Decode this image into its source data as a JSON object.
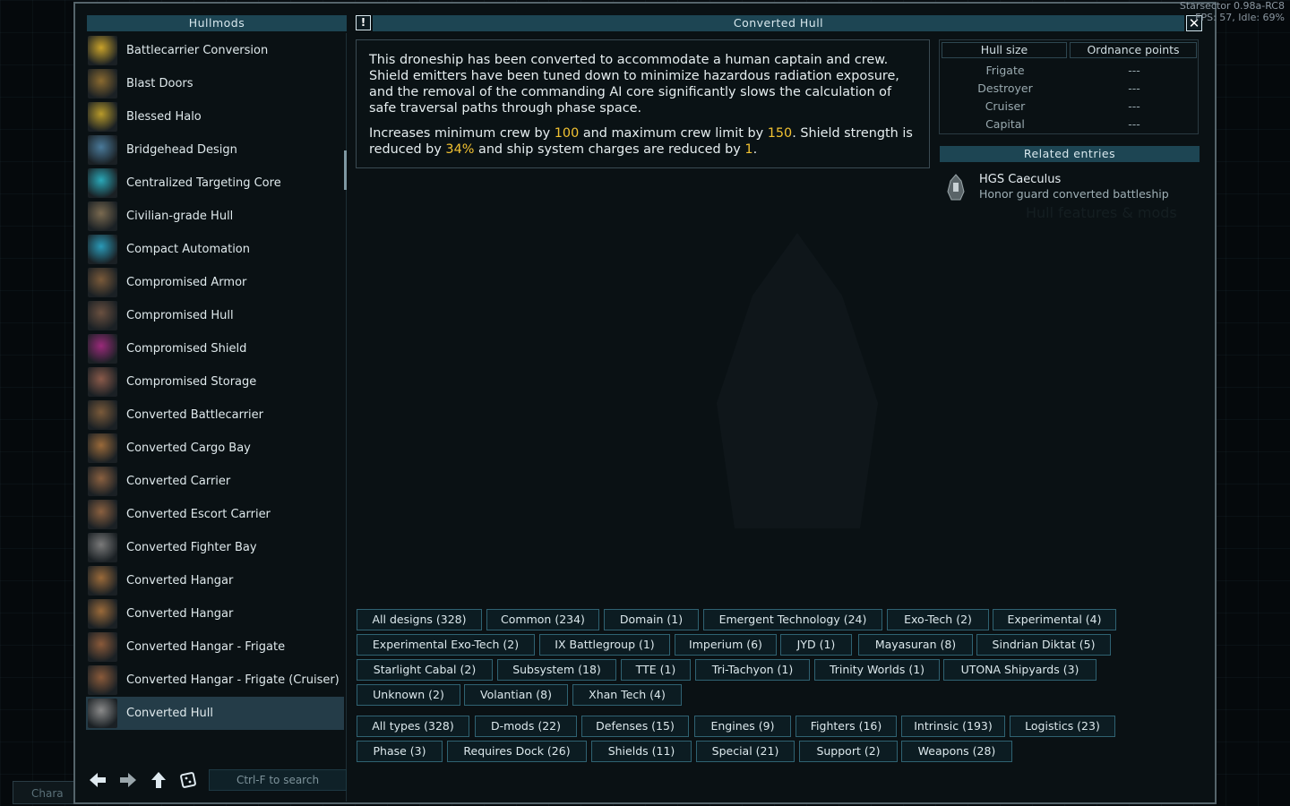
{
  "version": {
    "line1": "Starsector 0.98a-RC8",
    "line2": "FPS: 57, Idle: 69%"
  },
  "char_tab": "Chara",
  "hullmods_header": "Hullmods",
  "detail_header": "Converted Hull",
  "warning_icon": "!",
  "close_icon": "✕",
  "list_items": [
    {
      "label": "Battlecarrier Conversion",
      "icon": "battlecarrier-icon",
      "color": "#c9a22a"
    },
    {
      "label": "Blast Doors",
      "icon": "blast-doors-icon",
      "color": "#8a6a30"
    },
    {
      "label": "Blessed Halo",
      "icon": "halo-icon",
      "color": "#b89a2a"
    },
    {
      "label": "Bridgehead Design",
      "icon": "bridgehead-icon",
      "color": "#4a7a9a"
    },
    {
      "label": "Centralized Targeting Core",
      "icon": "targeting-core-icon",
      "color": "#2aa8b8"
    },
    {
      "label": "Civilian-grade Hull",
      "icon": "civilian-hull-icon",
      "color": "#7a6a50"
    },
    {
      "label": "Compact Automation",
      "icon": "automation-icon",
      "color": "#2a9ab8"
    },
    {
      "label": "Compromised Armor",
      "icon": "compromised-armor-icon",
      "color": "#7a5a3a"
    },
    {
      "label": "Compromised Hull",
      "icon": "compromised-hull-icon",
      "color": "#6a5040"
    },
    {
      "label": "Compromised Shield",
      "icon": "compromised-shield-icon",
      "color": "#9a2a7a"
    },
    {
      "label": "Compromised Storage",
      "icon": "compromised-storage-icon",
      "color": "#8a5a4a"
    },
    {
      "label": "Converted Battlecarrier",
      "icon": "converted-battlecarrier-icon",
      "color": "#7a5a3a"
    },
    {
      "label": "Converted Cargo Bay",
      "icon": "cargo-bay-icon",
      "color": "#9a6a3a"
    },
    {
      "label": "Converted Carrier",
      "icon": "converted-carrier-icon",
      "color": "#8a6040"
    },
    {
      "label": "Converted Escort Carrier",
      "icon": "escort-carrier-icon",
      "color": "#8a6040"
    },
    {
      "label": "Converted Fighter Bay",
      "icon": "fighter-bay-icon",
      "color": "#7a7a7a"
    },
    {
      "label": "Converted Hangar",
      "icon": "hangar-icon",
      "color": "#9a6a3a"
    },
    {
      "label": "Converted Hangar",
      "icon": "hangar-icon",
      "color": "#9a6a3a"
    },
    {
      "label": "Converted Hangar - Frigate",
      "icon": "hangar-frigate-icon",
      "color": "#8a5a3a"
    },
    {
      "label": "Converted Hangar - Frigate (Cruiser)",
      "icon": "hangar-frigate-cruiser-icon",
      "color": "#8a5a3a"
    },
    {
      "label": "Converted Hull",
      "icon": "converted-hull-icon",
      "color": "#8a8a8a",
      "selected": true
    }
  ],
  "search_placeholder": "Ctrl-F to search",
  "description": {
    "p1": "This droneship has been converted to accommodate a human captain and crew. Shield emitters have been tuned down to minimize hazardous radiation exposure, and the removal of the commanding AI core significantly slows the calculation of safe traversal paths through phase space.",
    "p2_a": "Increases minimum crew by ",
    "p2_v1": "100",
    "p2_b": " and maximum crew limit by ",
    "p2_v2": "150",
    "p2_c": ". Shield strength is reduced by ",
    "p2_v3": "34%",
    "p2_d": " and ship system charges are reduced by ",
    "p2_v4": "1",
    "p2_e": "."
  },
  "hull_table": {
    "col_size": "Hull size",
    "col_op": "Ordnance points",
    "rows": [
      {
        "size": "Frigate",
        "op": "---"
      },
      {
        "size": "Destroyer",
        "op": "---"
      },
      {
        "size": "Cruiser",
        "op": "---"
      },
      {
        "size": "Capital",
        "op": "---"
      }
    ]
  },
  "related_header": "Related entries",
  "related": {
    "name": "HGS Caeculus",
    "sub": "Honor guard converted battleship"
  },
  "design_filters": [
    "All designs (328)",
    "Common (234)",
    "Domain (1)",
    "Emergent Technology (24)",
    "Exo-Tech (2)",
    "Experimental (4)",
    "Experimental Exo-Tech (2)",
    "IX Battlegroup (1)",
    "Imperium (6)",
    "JYD (1)",
    "Mayasuran (8)",
    "Sindrian Diktat (5)",
    "Starlight Cabal (2)",
    "Subsystem (18)",
    "TTE (1)",
    "Tri-Tachyon (1)",
    "Trinity Worlds (1)",
    "UTONA Shipyards (3)",
    "Unknown (2)",
    "Volantian (8)",
    "Xhan Tech (4)"
  ],
  "type_filters": [
    "All types (328)",
    "D-mods (22)",
    "Defenses (15)",
    "Engines (9)",
    "Fighters (16)",
    "Intrinsic (193)",
    "Logistics (23)",
    "Phase (3)",
    "Requires Dock (26)",
    "Shields (11)",
    "Special (21)",
    "Support (2)",
    "Weapons (28)"
  ]
}
